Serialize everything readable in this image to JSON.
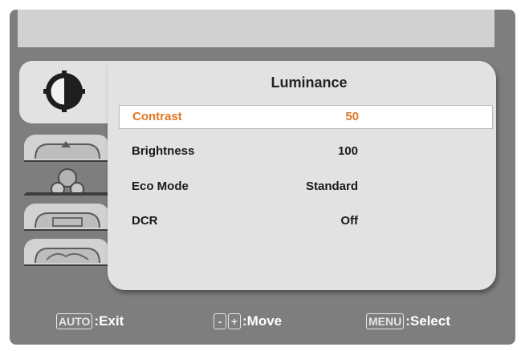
{
  "menu": {
    "title": "Luminance",
    "items": [
      {
        "label": "Contrast",
        "value": "50",
        "selected": true
      },
      {
        "label": "Brightness",
        "value": "100",
        "selected": false
      },
      {
        "label": "Eco Mode",
        "value": "Standard",
        "selected": false
      },
      {
        "label": "DCR",
        "value": "Off",
        "selected": false
      }
    ]
  },
  "tabs": [
    {
      "icon": "luminance-icon",
      "active": true
    },
    {
      "icon": "image-setup-icon",
      "active": false
    },
    {
      "icon": "color-temp-icon",
      "active": false
    },
    {
      "icon": "osd-setup-icon",
      "active": false
    },
    {
      "icon": "extra-icon",
      "active": false
    }
  ],
  "footer": {
    "exit_key": "AUTO",
    "exit_label": ":Exit",
    "minus_key": "-",
    "plus_key": "+",
    "move_label": ":Move",
    "menu_key": "MENU",
    "select_label": ":Select"
  },
  "colors": {
    "frame": "#7e7e7e",
    "panel": "#e2e2e2",
    "highlight": "#e07722",
    "title_bar": "#d1d1d1"
  }
}
